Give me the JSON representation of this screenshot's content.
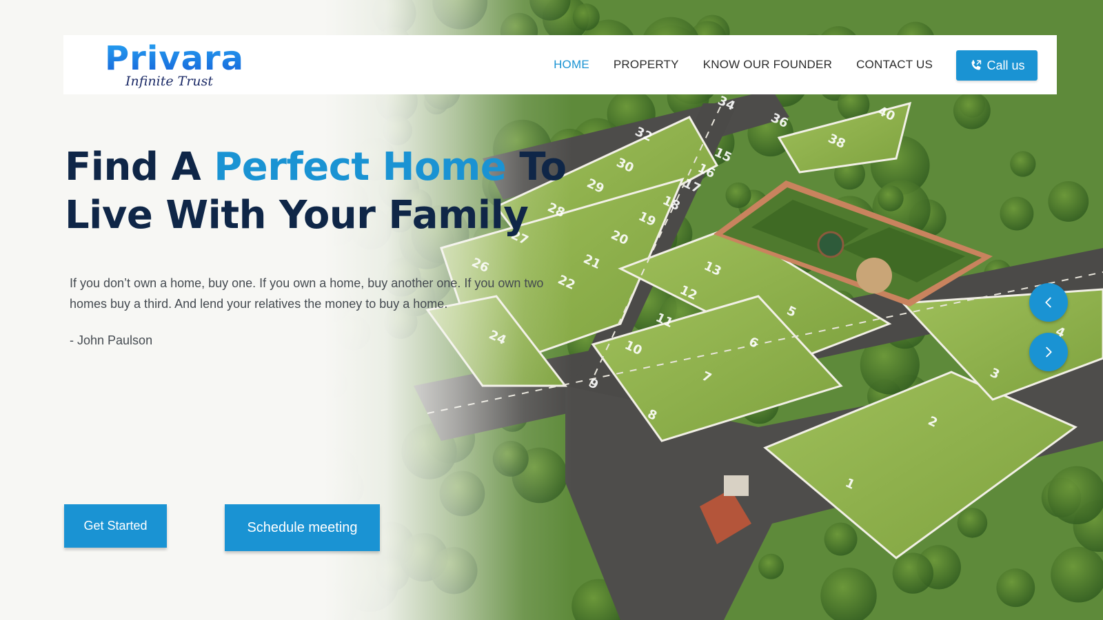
{
  "brand": {
    "name": "Privara",
    "tagline": "Infinite Trust"
  },
  "nav": {
    "items": [
      {
        "label": "HOME",
        "active": true
      },
      {
        "label": "PROPERTY",
        "active": false
      },
      {
        "label": "KNOW OUR FOUNDER",
        "active": false
      },
      {
        "label": "CONTACT US",
        "active": false
      }
    ],
    "call_label": "Call us",
    "call_icon": "phone-icon"
  },
  "hero": {
    "headline_part1": "Find A ",
    "headline_accent": "Perfect Home",
    "headline_part2": " To",
    "headline_line2": "Live With Your Family",
    "quote": "If you don’t own a home, buy one. If you own a home, buy another one. If you own two homes buy a third. And lend your relatives the money to buy a home.",
    "author": "- John Paulson",
    "primary_cta": "Get Started",
    "secondary_cta": "Schedule meeting"
  },
  "slider": {
    "prev_icon": "chevron-left-icon",
    "next_icon": "chevron-right-icon"
  },
  "plots": {
    "numbers": [
      "1",
      "2",
      "3",
      "4",
      "5",
      "6",
      "7",
      "8",
      "9",
      "10",
      "11",
      "12",
      "13",
      "15",
      "16",
      "17",
      "18",
      "19",
      "20",
      "21",
      "22",
      "24",
      "26",
      "27",
      "28",
      "29",
      "30",
      "32",
      "34",
      "36",
      "38",
      "40"
    ]
  },
  "colors": {
    "accent": "#1a93d3",
    "headline": "#0f2647",
    "body_text": "#444a50",
    "nav_text": "#2b2b2b"
  }
}
